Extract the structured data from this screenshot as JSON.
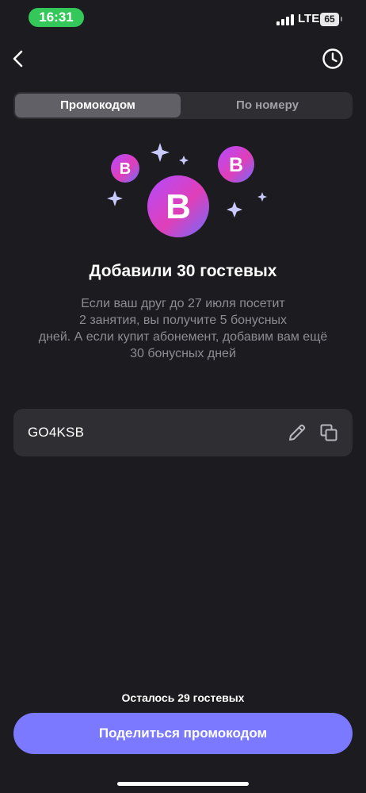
{
  "status_bar": {
    "time": "16:31",
    "network": "LTE",
    "battery": "65",
    "time_pill_color": "#34c759"
  },
  "nav": {
    "back_icon": "chevron-left-icon",
    "history_icon": "clock-icon"
  },
  "tabs": [
    {
      "label": "Промокодом",
      "active": true
    },
    {
      "label": "По номеру",
      "active": false
    }
  ],
  "illustration": {
    "badge_letter": "B",
    "gradient": [
      "#a94dff",
      "#e23fb4",
      "#6b6cff"
    ],
    "sparkle_color": "#c9cbff"
  },
  "content": {
    "headline": "Добавили 30 гостевых",
    "description_lines": [
      "Если ваш друг до 27 июля посетит",
      "2 занятия, вы получите 5 бонусных",
      "дней. А если купит абонемент, добавим вам ещё",
      "30 бонусных дней"
    ]
  },
  "promo": {
    "code": "GO4KSB",
    "edit_icon": "pencil-icon",
    "copy_icon": "copy-icon"
  },
  "footer": {
    "remaining": "Осталось 29 гостевых",
    "share_label": "Поделиться промокодом",
    "accent": "#7b79ff"
  }
}
